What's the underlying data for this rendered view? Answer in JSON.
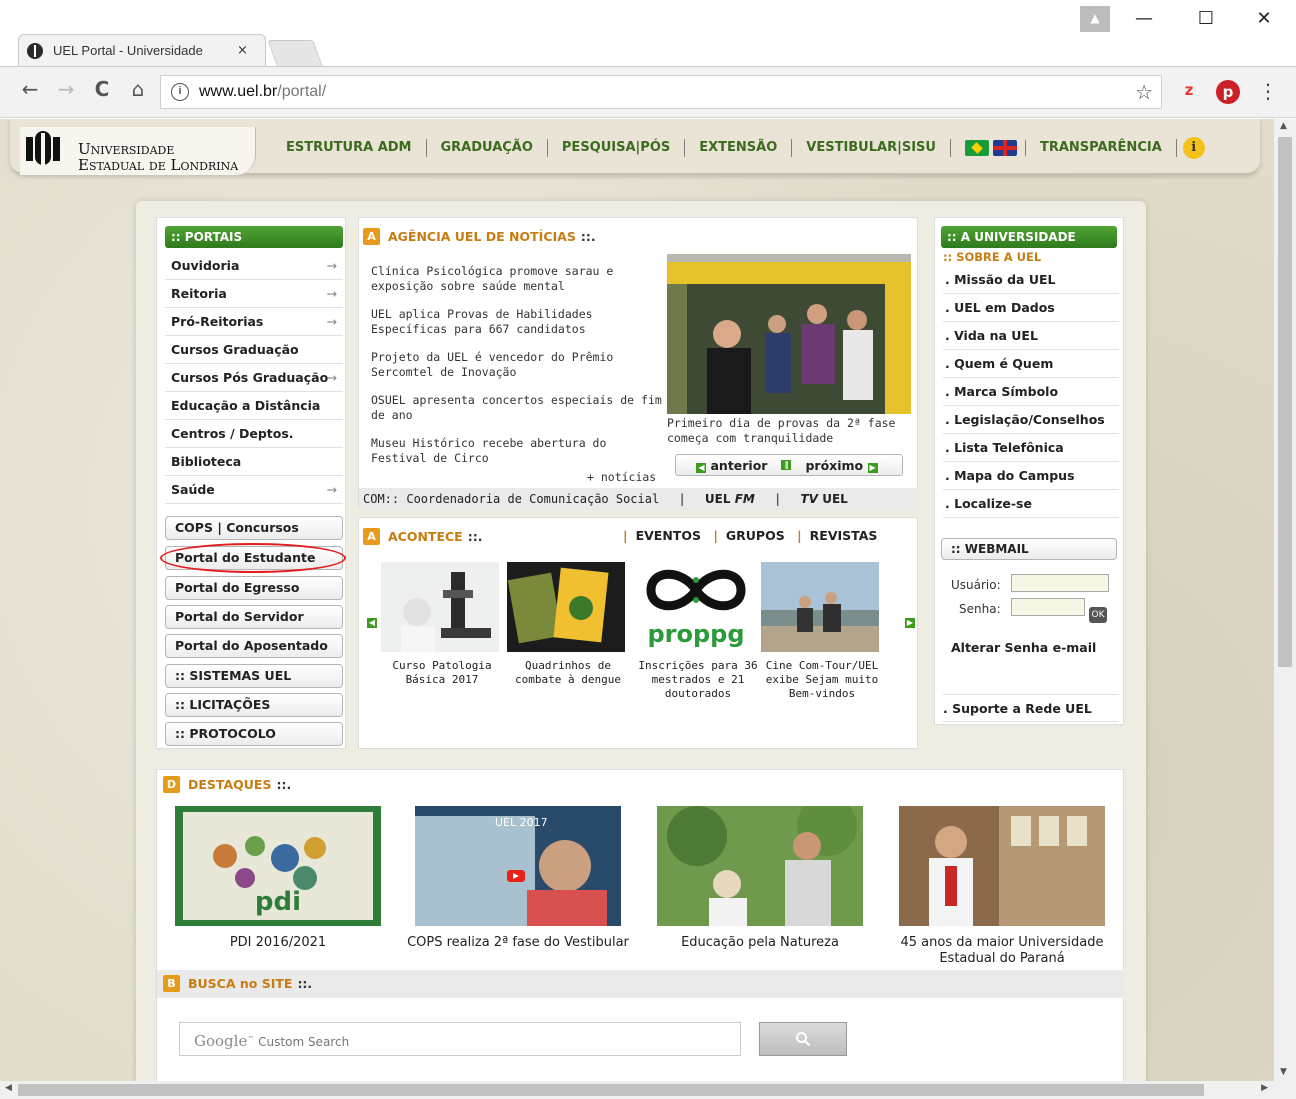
{
  "browser": {
    "tab_title": "UEL Portal - Universidade",
    "tab_close": "×",
    "url_host": "www.uel.br",
    "url_path": "/portal/",
    "info_icon": "i",
    "star_icon": "☆",
    "ext_z": "z",
    "ext_pinterest": "p",
    "menu_icon": "⋮",
    "back_icon": "←",
    "forward_icon": "→",
    "reload_icon": "C",
    "home_icon": "⌂",
    "minimize": "—",
    "maximize": "☐",
    "close": "✕",
    "profile_icon": "▲"
  },
  "header": {
    "logo_line1": "Universidade",
    "logo_line2": "Estadual de Londrina",
    "nav": [
      "ESTRUTURA ADM",
      "GRADUAÇÃO",
      "PESQUISA|PÓS",
      "EXTENSÃO",
      "VESTIBULAR|SISU"
    ],
    "transparencia": "TRANSPARÊNCIA",
    "info_letter": "i"
  },
  "portais": {
    "title": ":: PORTAIS",
    "arrow": "→",
    "items": [
      {
        "label": "Ouvidoria",
        "arrow": true
      },
      {
        "label": "Reitoria",
        "arrow": true
      },
      {
        "label": "Pró-Reitorias",
        "arrow": true
      },
      {
        "label": "Cursos Graduação",
        "arrow": false
      },
      {
        "label": "Cursos Pós Graduação",
        "arrow": true
      },
      {
        "label": "Educação a Distância",
        "arrow": false
      },
      {
        "label": "Centros / Deptos.",
        "arrow": false
      },
      {
        "label": "Biblioteca",
        "arrow": false
      },
      {
        "label": "Saúde",
        "arrow": true
      }
    ],
    "buttons": [
      "COPS | Concursos",
      "Portal do Estudante",
      "Portal do Egresso",
      "Portal do Servidor",
      "Portal do Aposentado",
      ":: SISTEMAS UEL",
      ":: LICITAÇÕES",
      ":: PROTOCOLO"
    ]
  },
  "noticias": {
    "letter": "A",
    "title": "AGÊNCIA UEL DE NOTÍCIAS",
    "tail": "::.",
    "items": [
      "Clínica Psicológica promove sarau e exposição sobre saúde mental",
      "UEL aplica Provas de Habilidades Específicas para 667 candidatos",
      "Projeto da UEL é vencedor do Prêmio Sercomtel de Inovação",
      "OSUEL apresenta concertos especiais de fim de ano",
      "Museu Histórico recebe abertura do Festival de Circo"
    ],
    "more": "+ notícias",
    "photo_caption": "Primeiro dia de provas da 2ª fase começa com tranquilidade",
    "prev": "anterior",
    "next": "próximo",
    "footer_com": "COM:: Coordenadoria de Comunicação Social",
    "footer_sep": "|",
    "footer_uelfm_a": "UEL",
    "footer_uelfm_b": "FM",
    "footer_tv_a": "TV",
    "footer_tv_b": "UEL"
  },
  "acontece": {
    "letter": "A",
    "title": "ACONTECE",
    "tail": "::.",
    "sep": "|",
    "links": [
      "EVENTOS",
      "GRUPOS",
      "REVISTAS"
    ],
    "items": [
      "Curso Patologia Básica 2017",
      "Quadrinhos de combate à dengue",
      "Inscrições para 36 mestrados e 21 doutorados",
      "Cine Com-Tour/UEL exibe Sejam muito Bem-vindos"
    ],
    "proppg_logo": "proppg"
  },
  "universidade": {
    "title": ":: A UNIVERSIDADE",
    "sub": ":: SOBRE A UEL",
    "items": [
      ". Missão da UEL",
      ". UEL em Dados",
      ". Vida na UEL",
      ". Quem é Quem",
      ". Marca Símbolo",
      ". Legislação/Conselhos",
      ". Lista Telefônica",
      ". Mapa do Campus",
      ". Localize-se"
    ],
    "webmail": ":: WEBMAIL",
    "usuario": "Usuário:",
    "senha": "Senha:",
    "ok": "OK",
    "alterar": "Alterar Senha e-mail",
    "suporte": ". Suporte a Rede UEL"
  },
  "destaques": {
    "letter": "D",
    "title": "DESTAQUES",
    "tail": "::.",
    "items": [
      "PDI 2016/2021",
      "COPS realiza 2ª fase do Vestibular",
      "Educação pela Natureza",
      "45 anos da maior Universidade Estadual do Paraná"
    ],
    "pdi_logo": "pdi",
    "video_banner": "UEL 2017"
  },
  "busca": {
    "letter": "B",
    "title": "BUSCA no SITE",
    "tail": "::.",
    "google": "Google",
    "tm": "™",
    "placeholder": "Custom Search",
    "search_icon": "🔍"
  },
  "scroll": {
    "up": "▲",
    "down": "▼",
    "left": "◀",
    "right": "▶"
  }
}
